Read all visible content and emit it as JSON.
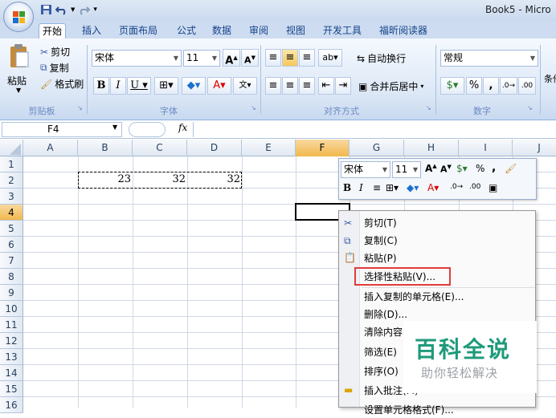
{
  "window": {
    "title": "Book5 - Micro"
  },
  "tabs": [
    "开始",
    "插入",
    "页面布局",
    "公式",
    "数据",
    "审阅",
    "视图",
    "开发工具",
    "福昕阅读器"
  ],
  "ribbon": {
    "paste": "粘贴",
    "cut": "剪切",
    "copy": "复制",
    "format_painter": "格式刷",
    "clipboard_label": "剪贴板",
    "font_name": "宋体",
    "font_size": "11",
    "font_label": "字体",
    "wrap_text": "自动换行",
    "merge_center": "合并后居中",
    "alignment_label": "对齐方式",
    "number_format": "常规",
    "number_label": "数字",
    "conditional_partial": "条件"
  },
  "formula_bar": {
    "name_box": "F4",
    "fx": "fx",
    "formula": ""
  },
  "columns": [
    "A",
    "B",
    "C",
    "D",
    "E",
    "F",
    "G",
    "H",
    "I",
    "J"
  ],
  "rows": [
    "1",
    "2",
    "3",
    "4",
    "5",
    "6",
    "7",
    "8",
    "9",
    "10",
    "11",
    "12",
    "13",
    "14",
    "15",
    "16"
  ],
  "cells": {
    "B2": "23",
    "C2": "32",
    "D2": "32"
  },
  "mini_toolbar": {
    "font": "宋体",
    "size": "11",
    "percent": "%",
    "comma": ","
  },
  "context_menu": {
    "items": [
      "剪切(T)",
      "复制(C)",
      "粘贴(P)",
      "选择性粘贴(V)...",
      "插入复制的单元格(E)...",
      "删除(D)...",
      "清除内容",
      "筛选(E)",
      "排序(O)",
      "插入批注(M)",
      "设置单元格格式(F)..."
    ]
  },
  "watermark": {
    "title": "百科全说",
    "subtitle": "助你轻松解决"
  },
  "colors": {
    "accent": "#15428b",
    "highlight": "#e03c3c",
    "selected_header": "#f1b84d"
  }
}
